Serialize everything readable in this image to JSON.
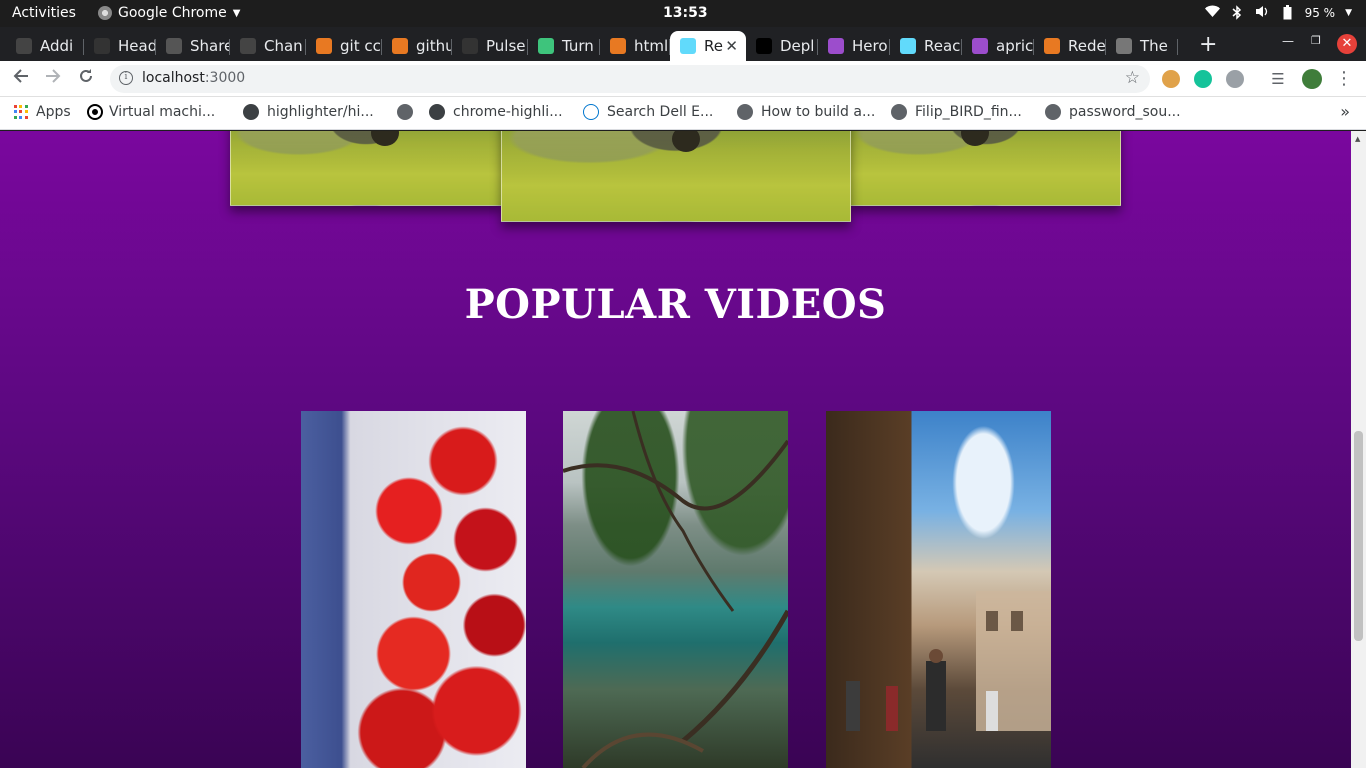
{
  "system": {
    "activities": "Activities",
    "app_name": "Google Chrome",
    "clock": "13:53",
    "battery": "95 %"
  },
  "tabs": [
    {
      "label": "Addi",
      "fav_color": "#444"
    },
    {
      "label": "Head",
      "fav_color": "#333"
    },
    {
      "label": "Share",
      "fav_color": "#555"
    },
    {
      "label": "Chan",
      "fav_color": "#444"
    },
    {
      "label": "git cc",
      "fav_color": "#e87922"
    },
    {
      "label": "githu",
      "fav_color": "#e87922"
    },
    {
      "label": "Pulse",
      "fav_color": "#333"
    },
    {
      "label": "Turn",
      "fav_color": "#3ec47c"
    },
    {
      "label": "html",
      "fav_color": "#e87922"
    },
    {
      "label": "Re",
      "fav_color": "#61dafb",
      "active": true
    },
    {
      "label": "Depl",
      "fav_color": "#000"
    },
    {
      "label": "Hero",
      "fav_color": "#9c4dcc"
    },
    {
      "label": "Reac",
      "fav_color": "#61dafb"
    },
    {
      "label": "apric",
      "fav_color": "#9c4dcc"
    },
    {
      "label": "Rede",
      "fav_color": "#e87922"
    },
    {
      "label": "The",
      "fav_color": "#777"
    }
  ],
  "omnibox": {
    "host": "localhost",
    "port": ":3000"
  },
  "bookmarks": [
    {
      "label": "Apps"
    },
    {
      "label": "Virtual machi..."
    },
    {
      "label": "highlighter/hi..."
    },
    {
      "label": ""
    },
    {
      "label": "chrome-highli..."
    },
    {
      "label": "Search Dell E..."
    },
    {
      "label": "How to build a..."
    },
    {
      "label": "Filip_BIRD_fin..."
    },
    {
      "label": "password_sou..."
    }
  ],
  "page": {
    "section_title": "POPULAR VIDEOS",
    "videos": [
      {
        "subject": "strawberries-and-blueberries"
      },
      {
        "subject": "mountain-lake"
      },
      {
        "subject": "old-town-square"
      }
    ]
  }
}
